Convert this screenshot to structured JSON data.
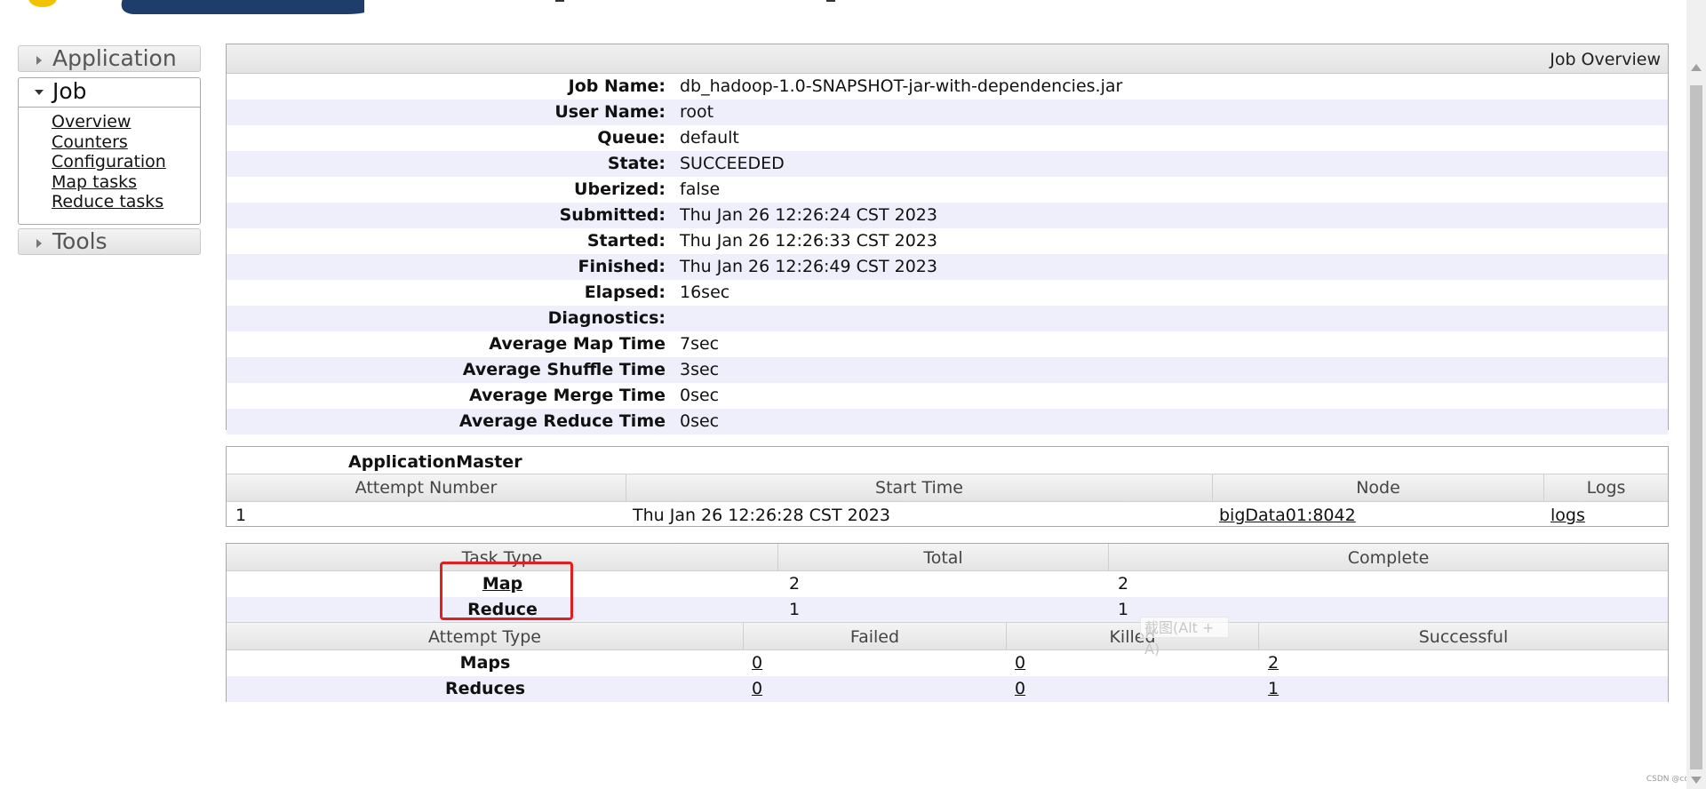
{
  "sidebar": {
    "application": "Application",
    "job": "Job",
    "job_links": [
      "Overview",
      "Counters",
      "Configuration",
      "Map tasks",
      "Reduce tasks"
    ],
    "tools": "Tools"
  },
  "overview": {
    "title": "Job Overview",
    "rows": [
      {
        "key": "Job Name:",
        "value": "db_hadoop-1.0-SNAPSHOT-jar-with-dependencies.jar"
      },
      {
        "key": "User Name:",
        "value": "root"
      },
      {
        "key": "Queue:",
        "value": "default"
      },
      {
        "key": "State:",
        "value": "SUCCEEDED"
      },
      {
        "key": "Uberized:",
        "value": "false"
      },
      {
        "key": "Submitted:",
        "value": "Thu Jan 26 12:26:24 CST 2023"
      },
      {
        "key": "Started:",
        "value": "Thu Jan 26 12:26:33 CST 2023"
      },
      {
        "key": "Finished:",
        "value": "Thu Jan 26 12:26:49 CST 2023"
      },
      {
        "key": "Elapsed:",
        "value": "16sec"
      },
      {
        "key": "Diagnostics:",
        "value": ""
      },
      {
        "key": "Average Map Time",
        "value": "7sec"
      },
      {
        "key": "Average Shuffle Time",
        "value": "3sec"
      },
      {
        "key": "Average Merge Time",
        "value": "0sec"
      },
      {
        "key": "Average Reduce Time",
        "value": "0sec"
      }
    ]
  },
  "app_master": {
    "title": "ApplicationMaster",
    "headers": [
      "Attempt Number",
      "Start Time",
      "Node",
      "Logs"
    ],
    "row": {
      "attempt": "1",
      "start_time": "Thu Jan 26 12:26:28 CST 2023",
      "node": "bigData01:8042",
      "logs": "logs"
    }
  },
  "tasks": {
    "headers": [
      "Task Type",
      "Total",
      "Complete"
    ],
    "rows": [
      {
        "type": "Map",
        "total": "2",
        "complete": "2"
      },
      {
        "type": "Reduce",
        "total": "1",
        "complete": "1"
      }
    ],
    "attempt_headers": [
      "Attempt Type",
      "Failed",
      "Killed",
      "Successful"
    ],
    "attempt_rows": [
      {
        "type": "Maps",
        "failed": "0",
        "killed": "0",
        "successful": "2"
      },
      {
        "type": "Reduces",
        "failed": "0",
        "killed": "0",
        "successful": "1"
      }
    ]
  },
  "tooltip": "截图(Alt + A)",
  "watermark": "CSDN @ccp",
  "colors": {
    "annotation": "#e02020",
    "row_alt": "#eeeffb"
  }
}
